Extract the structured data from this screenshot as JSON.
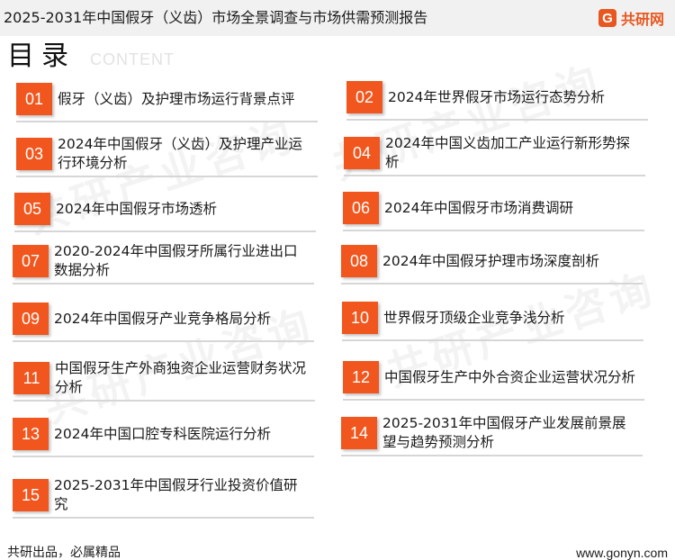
{
  "header": {
    "title": "2025-2031年中国假牙（义齿）市场全景调查与市场供需预测报告",
    "brand_icon": "G",
    "brand_name": "共研网",
    "brand_color": "#e8571f"
  },
  "section": {
    "heading": "目录",
    "subheading": "CONTENT"
  },
  "watermark": {
    "text": "共研产业咨询"
  },
  "toc": {
    "accent_color": "#f0561d",
    "items": [
      {
        "num": "01",
        "title": "假牙（义齿）及护理市场运行背景点评"
      },
      {
        "num": "02",
        "title": "2024年世界假牙市场运行态势分析"
      },
      {
        "num": "03",
        "title": "2024年中国假牙（义齿）及护理产业运行环境分析"
      },
      {
        "num": "04",
        "title": "2024年中国义齿加工产业运行新形势探析"
      },
      {
        "num": "05",
        "title": "2024年中国假牙市场透析"
      },
      {
        "num": "06",
        "title": "2024年中国假牙市场消费调研"
      },
      {
        "num": "07",
        "title": "2020-2024年中国假牙所属行业进出口数据分析"
      },
      {
        "num": "08",
        "title": "2024年中国假牙护理市场深度剖析"
      },
      {
        "num": "09",
        "title": "2024年中国假牙产业竞争格局分析"
      },
      {
        "num": "10",
        "title": "世界假牙顶级企业竞争浅分析"
      },
      {
        "num": "11",
        "title": "中国假牙生产外商独资企业运营财务状况分析"
      },
      {
        "num": "12",
        "title": "中国假牙生产中外合资企业运营状况分析"
      },
      {
        "num": "13",
        "title": "2024年中国口腔专科医院运行分析"
      },
      {
        "num": "14",
        "title": "2025-2031年中国假牙产业发展前景展望与趋势预测分析"
      },
      {
        "num": "15",
        "title": "2025-2031年中国假牙行业投资价值研究"
      }
    ]
  },
  "footer": {
    "left": "共研出品，必属精品",
    "right": "www.gonyn.com"
  }
}
